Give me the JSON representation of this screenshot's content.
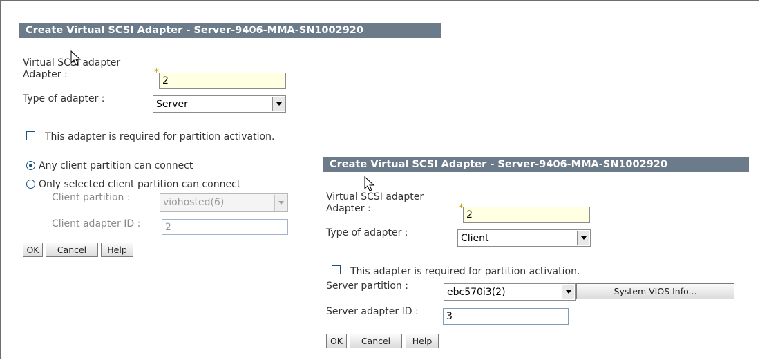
{
  "left_panel": {
    "title": "Create Virtual SCSI Adapter - Server-9406-MMA-SN1002920",
    "virtual_scsi_adapter_label": "Virtual SCSI adapter",
    "adapter_label": "Adapter :",
    "required_mark": "*",
    "adapter_value": "2",
    "type_label": "Type of adapter :",
    "type_value": "Server",
    "activation_checkbox_label": "This adapter is required for partition activation.",
    "activation_checked": false,
    "radio_any_label": "Any client partition can connect",
    "radio_only_label": "Only selected client partition can connect",
    "selected_radio": "any",
    "client_partition_label": "Client partition :",
    "client_partition_value": "viohosted(6)",
    "client_adapter_id_label": "Client adapter ID :",
    "client_adapter_id_value": "2",
    "buttons": {
      "ok": "OK",
      "cancel": "Cancel",
      "help": "Help"
    }
  },
  "right_panel": {
    "title": "Create Virtual SCSI Adapter - Server-9406-MMA-SN1002920",
    "virtual_scsi_adapter_label": "Virtual SCSI adapter",
    "adapter_label": "Adapter :",
    "required_mark": "*",
    "adapter_value": "2",
    "type_label": "Type of adapter :",
    "type_value": "Client",
    "activation_checkbox_label": "This adapter is required for partition activation.",
    "activation_checked": false,
    "server_partition_label": "Server partition :",
    "server_partition_value": "ebc570i3(2)",
    "system_vios_button": "System VIOS Info...",
    "server_adapter_id_label": "Server adapter ID :",
    "server_adapter_id_value": "3",
    "buttons": {
      "ok": "OK",
      "cancel": "Cancel",
      "help": "Help"
    }
  },
  "colors": {
    "title_bar": "#6b7b8a",
    "required_field": "#ffffe1",
    "required_mark": "#c8a000",
    "control_border": "#1c5180"
  },
  "icons": [
    "mouse-pointer-icon",
    "dropdown-arrow-icon"
  ]
}
